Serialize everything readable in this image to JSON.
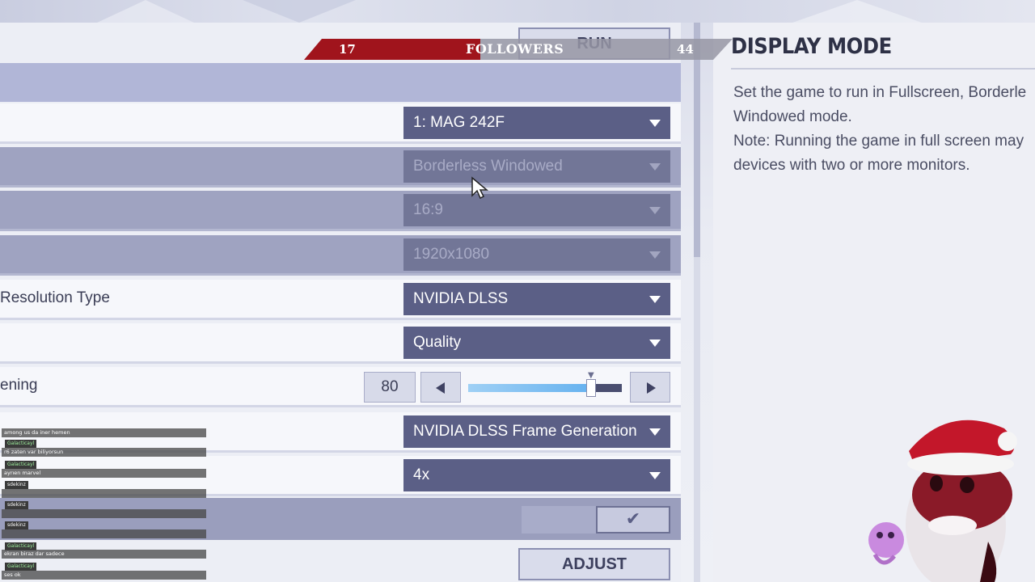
{
  "colors": {
    "panel_bg": "#eceef5",
    "dropdown_bg": "#5b5f86",
    "disabled_row_bg": "#9fa3c1",
    "followers_red": "#a0141c",
    "slider_fill": "#66b2ef"
  },
  "top_button": {
    "label": "RUN"
  },
  "followers": {
    "left_count": "17",
    "label": "FOLLOWERS",
    "right_count": "44"
  },
  "settings": {
    "monitor": {
      "value": "1: MAG 242F"
    },
    "display_mode": {
      "value": "Borderless Windowed"
    },
    "aspect_ratio": {
      "value": "16:9"
    },
    "resolution": {
      "value": "1920x1080"
    },
    "super_resolution_type": {
      "label": "Resolution Type",
      "value": "NVIDIA DLSS"
    },
    "super_resolution_mode": {
      "value": "Quality"
    },
    "sharpening": {
      "label": "ening",
      "value": "80",
      "level": 0.8
    },
    "frame_generation": {
      "value": "NVIDIA DLSS Frame Generation"
    },
    "frame_generation_multiplier": {
      "value": "4x"
    },
    "confirm_check": {
      "symbol": "✔"
    },
    "adjust_button": {
      "label": "ADJUST"
    }
  },
  "info": {
    "title": "DISPLAY MODE",
    "line1": "Set the game to run in Fullscreen, Borderle",
    "line2": "Windowed mode.",
    "line3": "Note: Running the game in full screen may",
    "line4": "devices with two or more monitors."
  },
  "chat": {
    "messages": [
      {
        "text": "among us da iner hemen"
      },
      {
        "user": "Galacticayl",
        "text": "r6 zaten var biliyorsun"
      },
      {
        "user": "Galacticayl",
        "text": "ayrıen marvel"
      },
      {
        "user": "sdekinz",
        "text": ""
      },
      {
        "user": "sdekinz",
        "text": ""
      },
      {
        "user": "sdekinz",
        "text": ""
      },
      {
        "user": "Galacticayl",
        "text": "ekran biraz dar sadece"
      },
      {
        "user": "Galacticayl",
        "text": "ses ok"
      }
    ]
  },
  "icons": {
    "caret": "chevron-down-icon",
    "left_arrow": "arrow-left-icon",
    "right_arrow": "arrow-right-icon",
    "cursor": "mouse-pointer-icon",
    "mascot": "santa-hat-shark-mascot"
  }
}
